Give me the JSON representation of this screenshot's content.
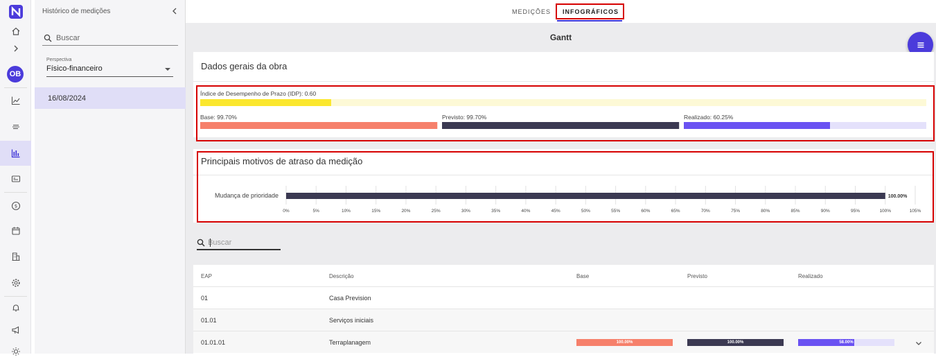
{
  "rail": {
    "avatar": "OB",
    "items": [
      "home-icon",
      "chevron-right-icon",
      "chart-line-icon",
      "list-icon",
      "bar-chart-icon",
      "card-icon",
      "money-icon",
      "calendar-icon",
      "building-icon",
      "gear-icon",
      "bell-icon",
      "megaphone-icon",
      "sun-icon"
    ],
    "active": "bar-chart-icon"
  },
  "panel": {
    "title": "Histórico de medições",
    "search_placeholder": "Buscar",
    "perspective_label": "Perspectiva",
    "perspective_value": "Físico-financeiro",
    "dates": [
      "16/08/2024"
    ]
  },
  "tabs": {
    "medicoes": "MEDIÇÕES",
    "infograficos": "INFOGRÁFICOS"
  },
  "page_title": "Gantt",
  "colors": {
    "accent": "#4b3bdb",
    "idp": "#fbe72e",
    "base": "#f6806b",
    "previsto": "#3b3952",
    "realizado": "#6a52f2",
    "highlight": "#d60000"
  },
  "dados_gerais": {
    "title": "Dados gerais da obra",
    "idp_label": "Índice de Desempenho de Prazo (IDP): 0.60",
    "idp_value": 0.6,
    "base_label": "Base: 99.70%",
    "base_value": 99.7,
    "previsto_label": "Previsto: 99.70%",
    "previsto_value": 99.7,
    "realizado_label": "Realizado: 60.25%",
    "realizado_value": 60.25
  },
  "motivos": {
    "title": "Principais motivos de atraso da medição",
    "chart_data": {
      "type": "bar",
      "orientation": "horizontal",
      "categories": [
        "Mudança de prioridade"
      ],
      "values": [
        100.0
      ],
      "data_labels": [
        "100.00%"
      ],
      "xlim": [
        0,
        105
      ],
      "xticks": [
        "0%",
        "5%",
        "10%",
        "15%",
        "20%",
        "25%",
        "30%",
        "35%",
        "40%",
        "45%",
        "50%",
        "55%",
        "60%",
        "65%",
        "70%",
        "75%",
        "80%",
        "85%",
        "90%",
        "95%",
        "100%",
        "105%"
      ],
      "grid": true
    }
  },
  "table_search_placeholder": "Buscar",
  "table": {
    "headers": {
      "eap": "EAP",
      "descricao": "Descrição",
      "base": "Base",
      "previsto": "Previsto",
      "realizado": "Realizado"
    },
    "rows": [
      {
        "eap": "01",
        "descricao": "Casa Prevision"
      },
      {
        "eap": "01.01",
        "descricao": "Serviços iniciais"
      },
      {
        "eap": "01.01.01",
        "descricao": "Terraplanagem",
        "base": "100.00%",
        "base_value": 100,
        "previsto": "100.00%",
        "previsto_value": 100,
        "realizado": "58.00%",
        "realizado_value": 58
      }
    ]
  }
}
